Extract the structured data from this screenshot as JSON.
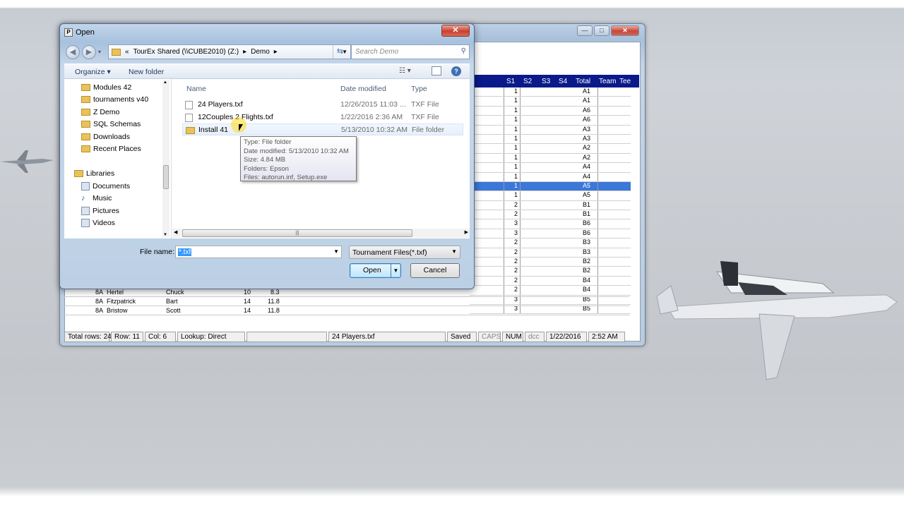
{
  "background_app": {
    "grid_headers": [
      "S1",
      "S2",
      "S3",
      "S4",
      "Total",
      "Team",
      "Tee"
    ],
    "grid_rows": [
      {
        "s1": "1",
        "team": "A1"
      },
      {
        "s1": "1",
        "team": "A1"
      },
      {
        "s1": "1",
        "team": "A6"
      },
      {
        "s1": "1",
        "team": "A6"
      },
      {
        "s1": "1",
        "team": "A3"
      },
      {
        "s1": "1",
        "team": "A3"
      },
      {
        "s1": "1",
        "team": "A2"
      },
      {
        "s1": "1",
        "team": "A2"
      },
      {
        "s1": "1",
        "team": "A4"
      },
      {
        "s1": "1",
        "team": "A4"
      },
      {
        "s1": "1",
        "team": "A5",
        "selected": true
      },
      {
        "s1": "1",
        "team": "A5"
      },
      {
        "s1": "2",
        "team": "B1"
      },
      {
        "s1": "2",
        "team": "B1"
      },
      {
        "s1": "3",
        "team": "B6"
      },
      {
        "s1": "3",
        "team": "B6"
      },
      {
        "s1": "2",
        "team": "B3"
      },
      {
        "s1": "2",
        "team": "B3"
      },
      {
        "s1": "2",
        "team": "B2"
      },
      {
        "s1": "2",
        "team": "B2"
      },
      {
        "s1": "2",
        "team": "B4"
      },
      {
        "s1": "2",
        "team": "B4"
      },
      {
        "s1": "3",
        "team": "B5"
      },
      {
        "s1": "3",
        "team": "B5"
      }
    ],
    "bottom_rows": [
      {
        "flight": "8A",
        "last": "Hertel",
        "first": "Chuck",
        "hdcp": "10",
        "idx": "8.3"
      },
      {
        "flight": "8A",
        "last": "Fitzpatrick",
        "first": "Bart",
        "hdcp": "14",
        "idx": "11.8"
      },
      {
        "flight": "8A",
        "last": "Bristow",
        "first": "Scott",
        "hdcp": "14",
        "idx": "11.8"
      }
    ],
    "status": {
      "total_rows": "Total rows: 24",
      "row": "Row: 11",
      "col": "Col: 6",
      "lookup": "Lookup: Direct",
      "file": "24 Players.txf",
      "saved": "Saved",
      "caps": "CAPS",
      "num": "NUM",
      "dcc": "dcc",
      "date": "1/22/2016",
      "time": "2:52 AM"
    }
  },
  "dialog": {
    "title": "Open",
    "close_glyph": "✕",
    "address": {
      "prefix": "«",
      "segments": [
        "TourEx Shared (\\\\CUBE2010) (Z:)",
        "Demo"
      ],
      "sep": "▸"
    },
    "search_placeholder": "Search Demo",
    "toolbar": {
      "organize": "Organize ▾",
      "new_folder": "New folder"
    },
    "nav_items": [
      {
        "label": "Modules 42",
        "kind": "folder"
      },
      {
        "label": "tournaments v40",
        "kind": "folder"
      },
      {
        "label": "Z Demo",
        "kind": "folder"
      },
      {
        "label": "SQL Schemas",
        "kind": "folder"
      },
      {
        "label": "Downloads",
        "kind": "folder"
      },
      {
        "label": "Recent Places",
        "kind": "folder"
      },
      {
        "label": "Libraries",
        "kind": "library"
      },
      {
        "label": "Documents",
        "kind": "doc"
      },
      {
        "label": "Music",
        "kind": "music"
      },
      {
        "label": "Pictures",
        "kind": "pic"
      },
      {
        "label": "Videos",
        "kind": "video"
      }
    ],
    "columns": {
      "name": "Name",
      "date": "Date modified",
      "type": "Type"
    },
    "files": [
      {
        "name": "24 Players.txf",
        "date": "12/26/2015 11:03 ...",
        "type": "TXF File",
        "icon": "file"
      },
      {
        "name": "12Couples 2 Flights.txf",
        "date": "1/22/2016 2:36 AM",
        "type": "TXF File",
        "icon": "file"
      },
      {
        "name": "Install 41",
        "date": "5/13/2010 10:32 AM",
        "type": "File folder",
        "icon": "folder"
      }
    ],
    "tooltip": [
      "Type: File folder",
      "Date modified: 5/13/2010 10:32 AM",
      "Size: 4.84 MB",
      "Folders: Epson",
      "Files: autorun.inf, Setup.exe"
    ],
    "file_name_label": "File name:",
    "file_name_value": "*.txf",
    "file_type": "Tournament Files(*.txf)",
    "open_label": "Open",
    "cancel_label": "Cancel"
  }
}
